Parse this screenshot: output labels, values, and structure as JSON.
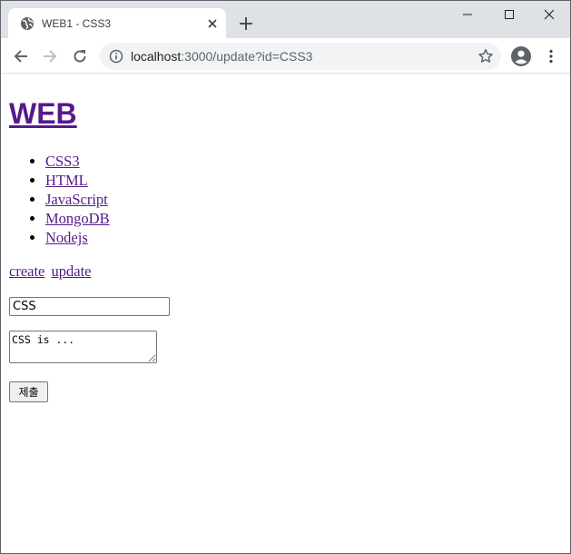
{
  "browser": {
    "tab_title": "WEB1 - CSS3",
    "url_host": "localhost",
    "url_rest": ":3000/update?id=CSS3"
  },
  "icons": {
    "favicon": "globe-icon",
    "tab_close": "close-icon",
    "new_tab": "plus-icon",
    "minimize": "minimize-icon",
    "maximize": "maximize-icon",
    "close_window": "close-icon",
    "back": "arrow-left-icon",
    "forward": "arrow-right-icon",
    "reload": "reload-icon",
    "site_info": "info-icon",
    "bookmark": "star-icon",
    "profile": "account-icon",
    "menu": "more-vert-icon"
  },
  "page": {
    "title": "WEB",
    "nav": [
      {
        "label": "CSS3"
      },
      {
        "label": "HTML"
      },
      {
        "label": "JavaScript"
      },
      {
        "label": "MongoDB"
      },
      {
        "label": "Nodejs"
      }
    ],
    "actions": {
      "create": "create",
      "update": "update"
    },
    "form": {
      "title_value": "CSS",
      "description_value": "CSS is ...",
      "submit_label": "제출"
    }
  },
  "colors": {
    "link_visited": "#551a8b",
    "tabstrip_bg": "#dee1e6",
    "omnibox_bg": "#f1f3f4"
  }
}
